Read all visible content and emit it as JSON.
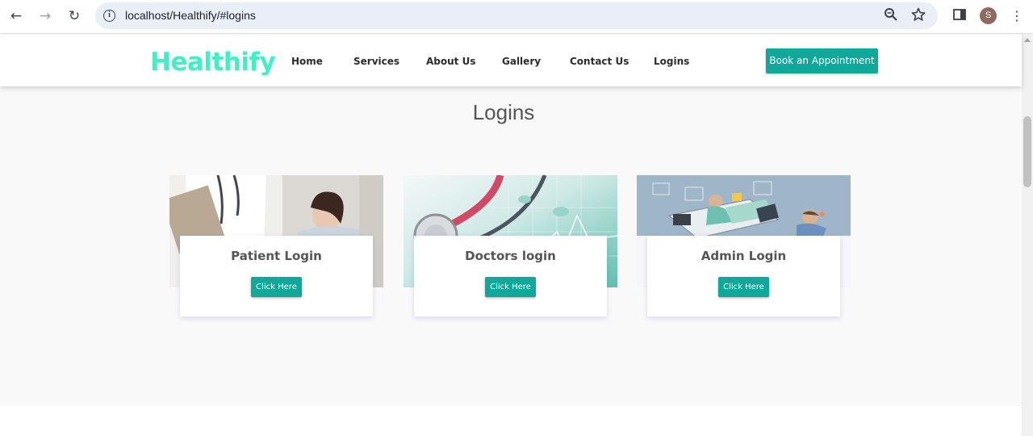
{
  "browser": {
    "url": "localhost/Healthify/#logins",
    "profile_initial": "S",
    "icons": [
      "back-icon",
      "forward-icon",
      "reload-icon",
      "info-icon",
      "zoom-icon",
      "star-icon",
      "side-panel-icon",
      "menu-icon"
    ]
  },
  "site": {
    "logo": "Healthify",
    "nav": [
      "Home",
      "Services",
      "About Us",
      "Gallery",
      "Contact Us",
      "Logins"
    ],
    "cta": "Book an Appointment",
    "colors": {
      "logo": "#3ef0c4",
      "accent": "#0fa89b"
    }
  },
  "logins": {
    "title": "Logins",
    "cards": [
      {
        "title": "Patient Login",
        "button": "Click Here"
      },
      {
        "title": "Doctors login",
        "button": "Click Here"
      },
      {
        "title": "Admin Login",
        "button": "Click Here"
      }
    ]
  }
}
